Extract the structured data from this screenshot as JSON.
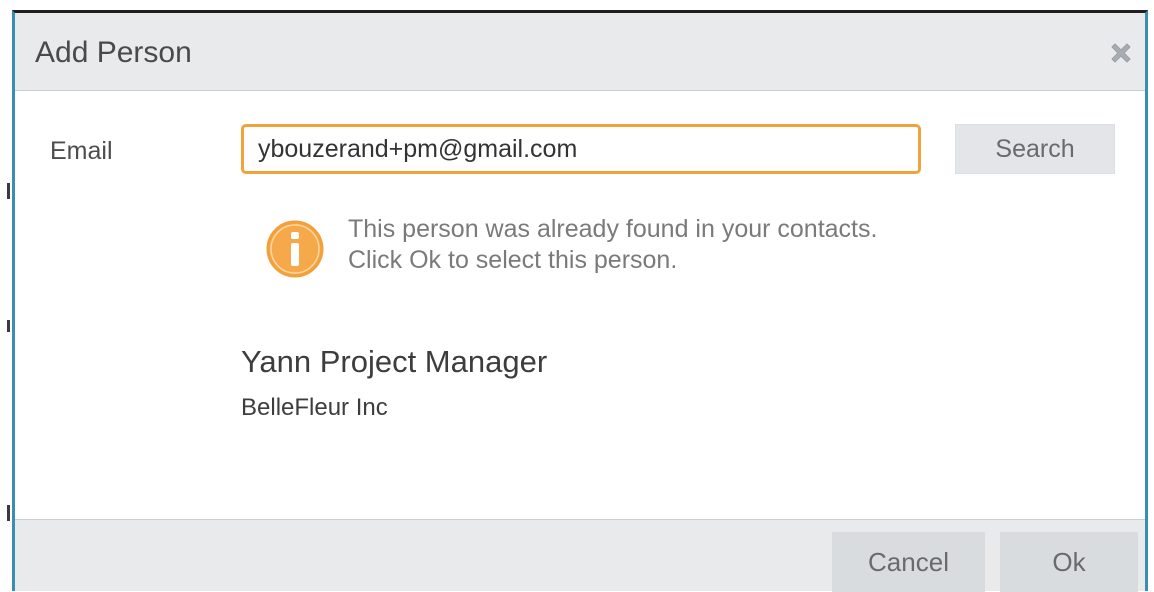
{
  "dialog": {
    "title": "Add Person",
    "close_icon": "close-icon"
  },
  "form": {
    "email_label": "Email",
    "email_value": "ybouzerand+pm@gmail.com",
    "search_label": "Search"
  },
  "notice": {
    "icon": "info-icon",
    "text": "This person was already found in your contacts.  Click Ok to select this person."
  },
  "person": {
    "name": "Yann Project Manager",
    "company": "BelleFleur Inc"
  },
  "footer": {
    "cancel_label": "Cancel",
    "ok_label": "Ok"
  },
  "colors": {
    "accent_orange": "#f0a33a",
    "dialog_border": "#3a8fb0",
    "header_bg": "#e8eaec"
  }
}
